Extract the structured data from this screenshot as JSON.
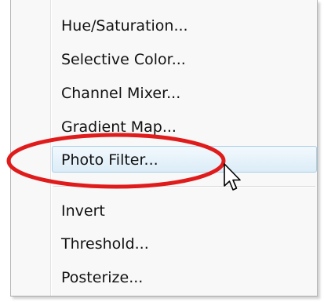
{
  "menu": {
    "items": [
      {
        "label": "Hue/Saturation..."
      },
      {
        "label": "Selective Color..."
      },
      {
        "label": "Channel Mixer..."
      },
      {
        "label": "Gradient Map..."
      },
      {
        "label": "Photo Filter..."
      },
      {
        "label": "Invert"
      },
      {
        "label": "Threshold..."
      },
      {
        "label": "Posterize..."
      }
    ],
    "highlighted_item": "Photo Filter...",
    "highlight_color": "#dcecf7",
    "annotation_color": "#e01b1b"
  },
  "cursor": {
    "icon": "arrow-pointer-icon"
  }
}
